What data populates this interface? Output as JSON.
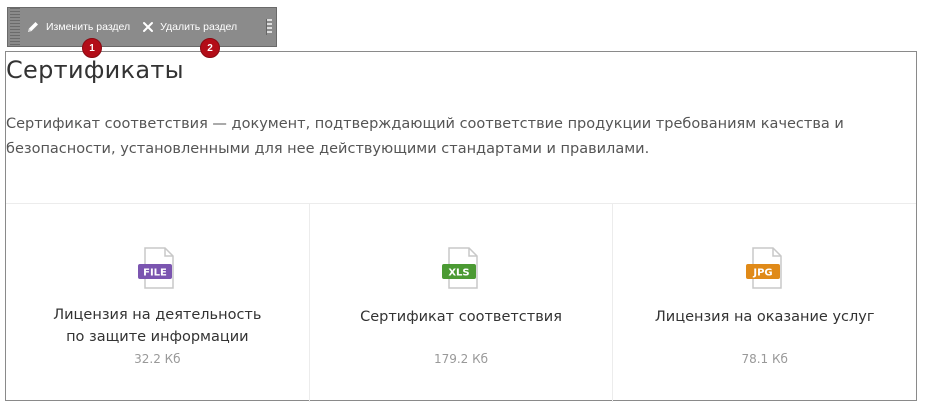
{
  "toolbar": {
    "edit_label": "Изменить раздел",
    "delete_label": "Удалить раздел",
    "badges": [
      "1",
      "2"
    ]
  },
  "section": {
    "title": "Сертификаты",
    "description": "Сертификат соответствия — документ, подтверждающий соответствие продукции требованиям качества и безопасности, установленными для нее действующими стандартами и правилами."
  },
  "documents": [
    {
      "ext": "FILE",
      "ext_color": "#7b55b0",
      "title_line1": "Лицензия на деятельность",
      "title_line2": "по защите информации",
      "size": "32.2 Кб"
    },
    {
      "ext": "XLS",
      "ext_color": "#4b9a33",
      "title_line1": "Сертификат соответствия",
      "title_line2": "",
      "size": "179.2 Кб"
    },
    {
      "ext": "JPG",
      "ext_color": "#e08a18",
      "title_line1": "Лицензия на оказание услуг",
      "title_line2": "",
      "size": "78.1 Кб"
    }
  ]
}
